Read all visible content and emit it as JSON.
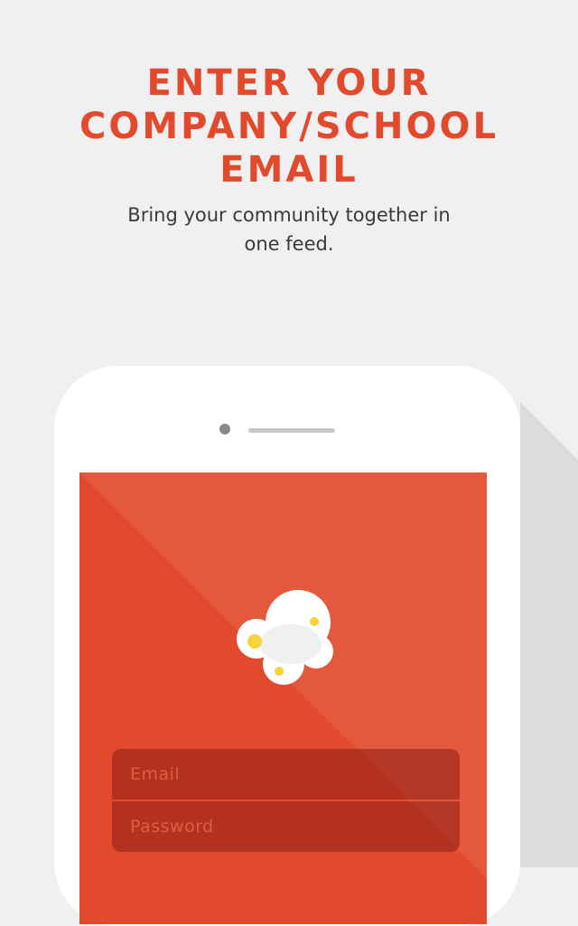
{
  "header": {
    "title_lines": [
      "ENTER YOUR",
      "COMPANY/SCHOOL",
      "EMAIL"
    ],
    "subtitle_lines": [
      "Bring your community together in",
      "one feed."
    ]
  },
  "login_form": {
    "email_placeholder": "Email",
    "password_placeholder": "Password"
  },
  "colors": {
    "accent": "#e24a2e",
    "background": "#f0f0f0",
    "logo_dots": "#f7d23a"
  },
  "icons": {
    "app_logo": "popcorn-cloud-icon"
  }
}
